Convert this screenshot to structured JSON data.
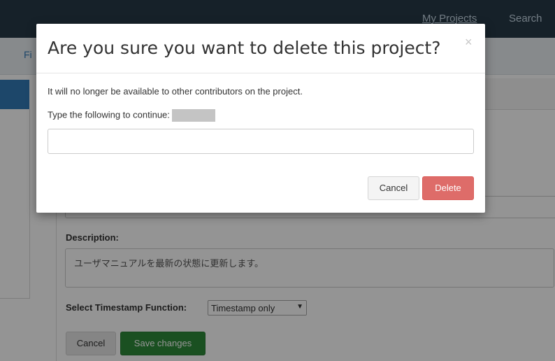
{
  "nav": {
    "my_projects": "My Projects",
    "search": "Search"
  },
  "subnav": {
    "files_partial": "Fi"
  },
  "form": {
    "description_label": "Description:",
    "description_value": "ユーザマニュアルを最新の状態に更新します。",
    "timestamp_label": "Select Timestamp Function:",
    "timestamp_selected": "Timestamp only",
    "cancel_label": "Cancel",
    "save_label": "Save changes"
  },
  "modal": {
    "title": "Are you sure you want to delete this project?",
    "message": "It will no longer be available to other contributors on the project.",
    "prompt": "Type the following to continue:",
    "input_value": "",
    "cancel_label": "Cancel",
    "delete_label": "Delete",
    "close_icon": "×"
  },
  "colors": {
    "navbar": "#263947",
    "primary": "#337ab7",
    "danger": "#d9534f",
    "success": "#2e8b3a"
  }
}
